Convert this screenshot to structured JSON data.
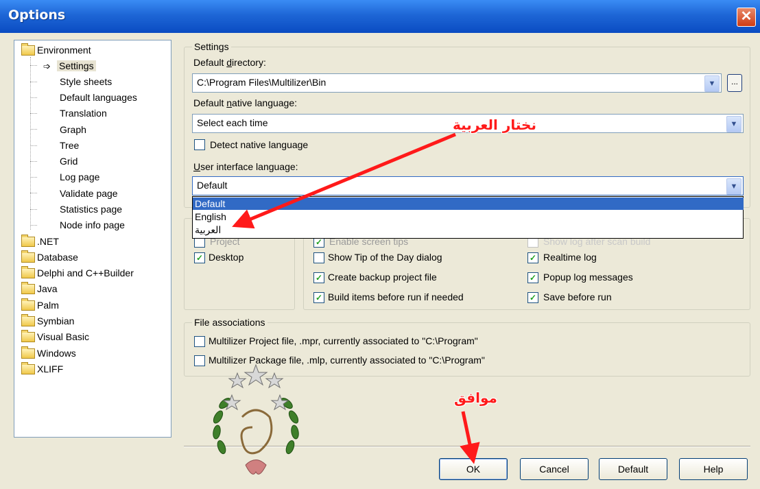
{
  "window": {
    "title": "Options",
    "close_glyph": "✕"
  },
  "tree": {
    "items": [
      {
        "label": "Environment",
        "type": "folder"
      },
      {
        "label": "Settings",
        "type": "selected"
      },
      {
        "label": "Style sheets",
        "type": "child"
      },
      {
        "label": "Default languages",
        "type": "child"
      },
      {
        "label": "Translation",
        "type": "child"
      },
      {
        "label": "Graph",
        "type": "child"
      },
      {
        "label": "Tree",
        "type": "child"
      },
      {
        "label": "Grid",
        "type": "child"
      },
      {
        "label": "Log page",
        "type": "child"
      },
      {
        "label": "Validate page",
        "type": "child"
      },
      {
        "label": "Statistics page",
        "type": "child"
      },
      {
        "label": "Node info page",
        "type": "child"
      },
      {
        "label": ".NET",
        "type": "folder"
      },
      {
        "label": "Database",
        "type": "folder"
      },
      {
        "label": "Delphi and C++Builder",
        "type": "folder"
      },
      {
        "label": "Java",
        "type": "folder"
      },
      {
        "label": "Palm",
        "type": "folder"
      },
      {
        "label": "Symbian",
        "type": "folder"
      },
      {
        "label": "Visual Basic",
        "type": "folder"
      },
      {
        "label": "Windows",
        "type": "folder"
      },
      {
        "label": "XLIFF",
        "type": "folder"
      }
    ]
  },
  "settings": {
    "group_title": "Settings",
    "default_directory": {
      "label_pre": "Default ",
      "label_u": "d",
      "label_post": "irectory:",
      "value": "C:\\Program Files\\Multilizer\\Bin",
      "browse": "..."
    },
    "native_language": {
      "label_pre": "Default ",
      "label_u": "n",
      "label_post": "ative language:",
      "value": "Select each time"
    },
    "detect_native": {
      "label": "Detect native language",
      "checked": false
    },
    "ui_language": {
      "label_u": "U",
      "label_post": "ser interface language:",
      "value": "Default",
      "options": [
        "Default",
        "English",
        "العربية"
      ],
      "selected_index": 0
    }
  },
  "misc": {
    "project_partial": "Project",
    "desktop": {
      "label": "Desktop",
      "checked": true
    },
    "enable_tips_partial": "Enable screen tips",
    "show_log_partial": "Show log after scan build",
    "show_tip": {
      "label": "Show Tip of the Day dialog",
      "checked": false
    },
    "create_backup": {
      "label": "Create backup project file",
      "checked": true
    },
    "build_items": {
      "label": "Build items before run if needed",
      "checked": true
    },
    "realtime_log": {
      "label": "Realtime log",
      "checked": true
    },
    "popup_log": {
      "label": "Popup log messages",
      "checked": true
    },
    "save_before_run": {
      "label": "Save before run",
      "checked": true
    }
  },
  "file_associations": {
    "group_title": "File associations",
    "project_file": {
      "label": "Multilizer Project file, .mpr, currently associated to \"C:\\Program\"",
      "checked": false
    },
    "package_file": {
      "label": "Multilizer Package file, .mlp, currently associated to \"C:\\Program\"",
      "checked": false
    }
  },
  "buttons": {
    "ok": "OK",
    "cancel": "Cancel",
    "default": "Default",
    "help": "Help"
  },
  "annotations": {
    "choose_arabic": "نختار العربية",
    "ok_arabic": "موافق"
  },
  "colors": {
    "title_bar": "#1e66d6",
    "annotation": "#ff1a1a",
    "selection": "#316ac5"
  }
}
